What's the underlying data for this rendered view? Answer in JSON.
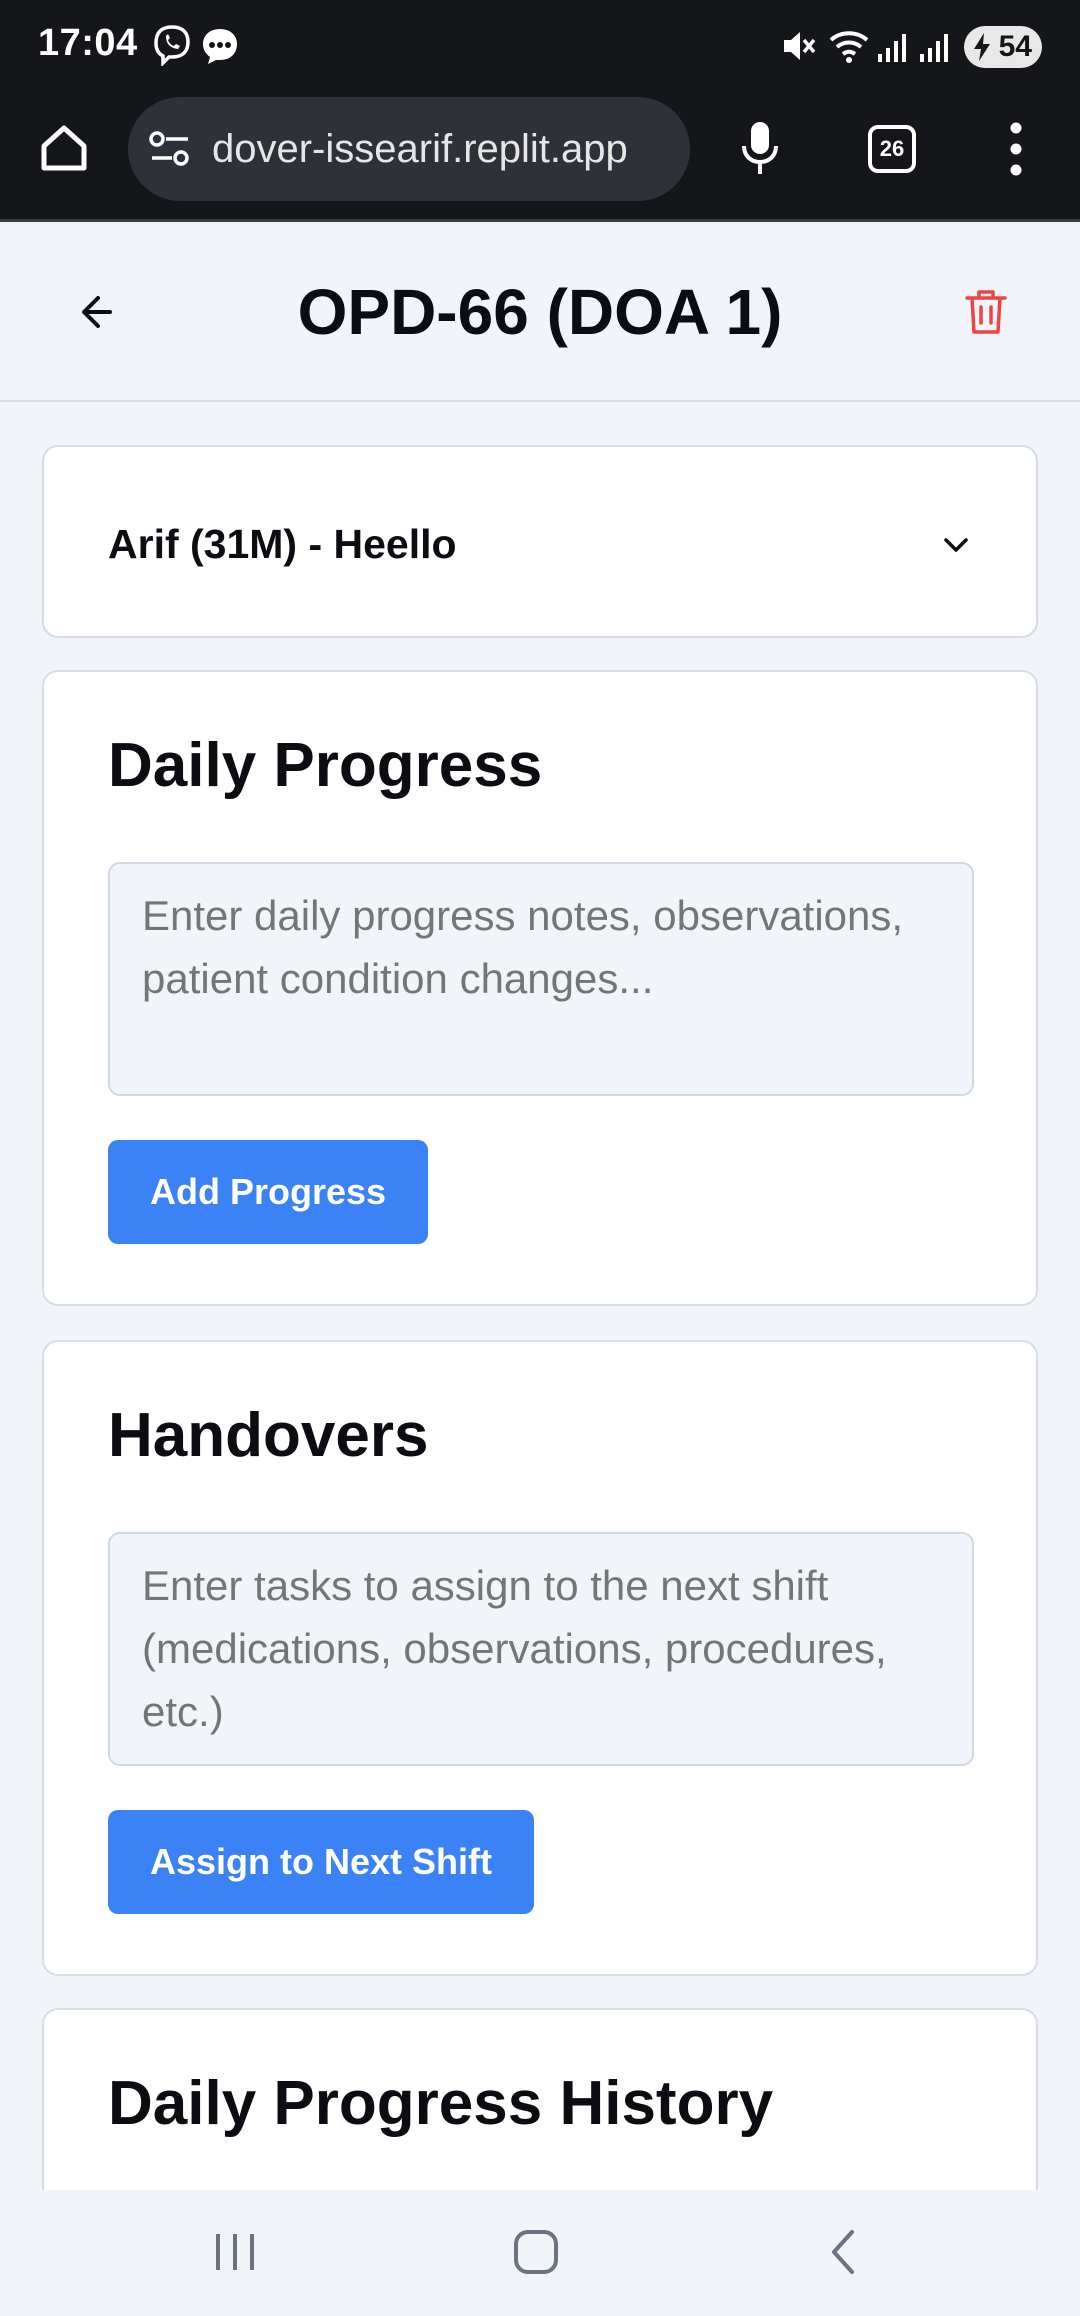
{
  "status_bar": {
    "time": "17:04",
    "battery": "54",
    "icons": [
      "viber-icon",
      "message-icon",
      "mute-icon",
      "wifi-icon",
      "signal-icon",
      "signal-icon",
      "battery-charging-icon"
    ]
  },
  "browser": {
    "url": "dover-issearif.replit.app",
    "tab_count": "26"
  },
  "header": {
    "title": "OPD-66 (DOA 1)"
  },
  "patient": {
    "label": "Arif (31M) - Heello"
  },
  "daily_progress": {
    "title": "Daily Progress",
    "placeholder": "Enter daily progress notes, observations, patient condition changes...",
    "button_label": "Add Progress"
  },
  "handovers": {
    "title": "Handovers",
    "placeholder": "Enter tasks to assign to the next shift (medications, observations, procedures, etc.)",
    "button_label": "Assign to Next Shift"
  },
  "history": {
    "title": "Daily Progress History"
  },
  "colors": {
    "primary": "#3b82f6",
    "danger": "#ef4444",
    "background": "#f1f5f9",
    "system_bar": "#14161a"
  }
}
